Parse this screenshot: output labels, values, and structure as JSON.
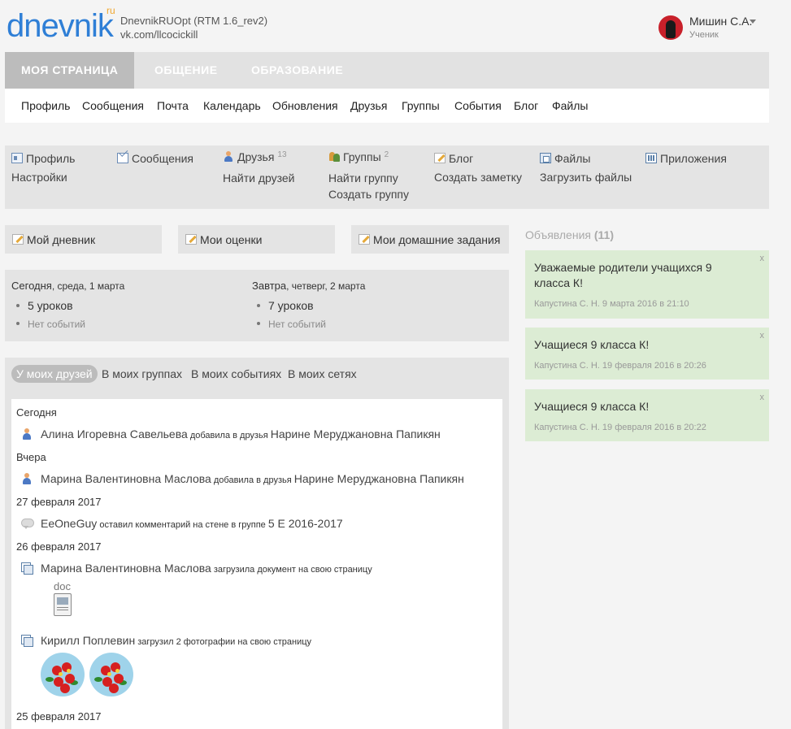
{
  "header": {
    "logo_text": "dnevnik",
    "logo_suffix": "ru",
    "app_version": "DnevnikRUOpt (RTM 1.6_rev2)",
    "app_link": "vk.com/llcocickill",
    "user_name": "Мишин С.А.",
    "user_role": "Ученик"
  },
  "topnav": {
    "tabs": [
      {
        "label": "МОЯ СТРАНИЦА"
      },
      {
        "label": "ОБЩЕНИЕ"
      },
      {
        "label": "ОБРАЗОВАНИЕ"
      }
    ]
  },
  "subnav": {
    "items": [
      {
        "label": "Профиль"
      },
      {
        "label": "Сообщения"
      },
      {
        "label": "Почта"
      },
      {
        "label": "Календарь"
      },
      {
        "label": "Обновления"
      },
      {
        "label": "Друзья"
      },
      {
        "label": "Группы"
      },
      {
        "label": "События"
      },
      {
        "label": "Блог"
      },
      {
        "label": "Файлы"
      }
    ]
  },
  "quick": {
    "profile": {
      "label": "Профиль",
      "sub": "Настройки"
    },
    "messages": {
      "label": "Сообщения"
    },
    "friends": {
      "label": "Друзья",
      "count": "13",
      "sub": "Найти друзей"
    },
    "groups": {
      "label": "Группы",
      "count": "2",
      "sub1": "Найти группу",
      "sub2": "Создать группу"
    },
    "blog": {
      "label": "Блог",
      "sub": "Создать заметку"
    },
    "files": {
      "label": "Файлы",
      "sub": "Загрузить файлы"
    },
    "apps": {
      "label": "Приложения"
    }
  },
  "diary": {
    "my_diary": "Мой дневник",
    "my_marks": "Мои оценки",
    "my_homework": "Мои домашние задания"
  },
  "days": {
    "today": {
      "prefix": "Сегодня",
      "date": ", среда, 1 марта",
      "lessons": "5 уроков",
      "events": "Нет событий"
    },
    "tomorrow": {
      "prefix": "Завтра",
      "date": ", четверг, 2 марта",
      "lessons": "7 уроков",
      "events": "Нет событий"
    }
  },
  "feed": {
    "tabs": [
      {
        "label": "У моих друзей"
      },
      {
        "label": "В моих группах"
      },
      {
        "label": "В моих событиях"
      },
      {
        "label": "В моих сетях"
      }
    ],
    "groups": [
      {
        "date": "Сегодня"
      },
      {
        "date": "Вчера"
      },
      {
        "date": "27 февраля 2017"
      },
      {
        "date": "26 февраля 2017"
      },
      {
        "date": "25 февраля 2017"
      }
    ],
    "items": [
      {
        "actor": "Алина Игоревна Савельева",
        "action": " добавила в друзья ",
        "target": "Нарине Меруджановна Папикян"
      },
      {
        "actor": "Марина Валентиновна Маслова",
        "action": " добавила в друзья ",
        "target": "Нарине Меруджановна Папикян"
      },
      {
        "actor": "EeOneGuy",
        "action": " оставил комментарий на стене в группе ",
        "target": "5 Е 2016-2017"
      },
      {
        "actor": "Марина Валентиновна Маслова",
        "action": " загрузила документ на свою страницу",
        "target": ""
      },
      {
        "actor": "Кирилл Поплевин",
        "action": " загрузил 2 фотографии на свою страницу",
        "target": ""
      }
    ],
    "doc_label": "doc"
  },
  "announcements": {
    "title": "Объявления",
    "count": "(11)",
    "close": "x",
    "items": [
      {
        "text": "Уважаемые родители учащихся 9 класса К!",
        "meta": "Капустина С. Н. 9 марта 2016 в 21:10"
      },
      {
        "text": "Учащиеся 9 класса К!",
        "meta": "Капустина С. Н. 19 февраля 2016 в 20:26"
      },
      {
        "text": "Учащиеся 9 класса К!",
        "meta": "Капустина С. Н. 19 февраля 2016 в 20:22"
      }
    ]
  },
  "colors": {
    "logo_blue": "#2f7fd6",
    "logo_orange": "#f0a830",
    "announcement_bg": "#dcecd4",
    "active_tab": "#bcbcbc"
  }
}
